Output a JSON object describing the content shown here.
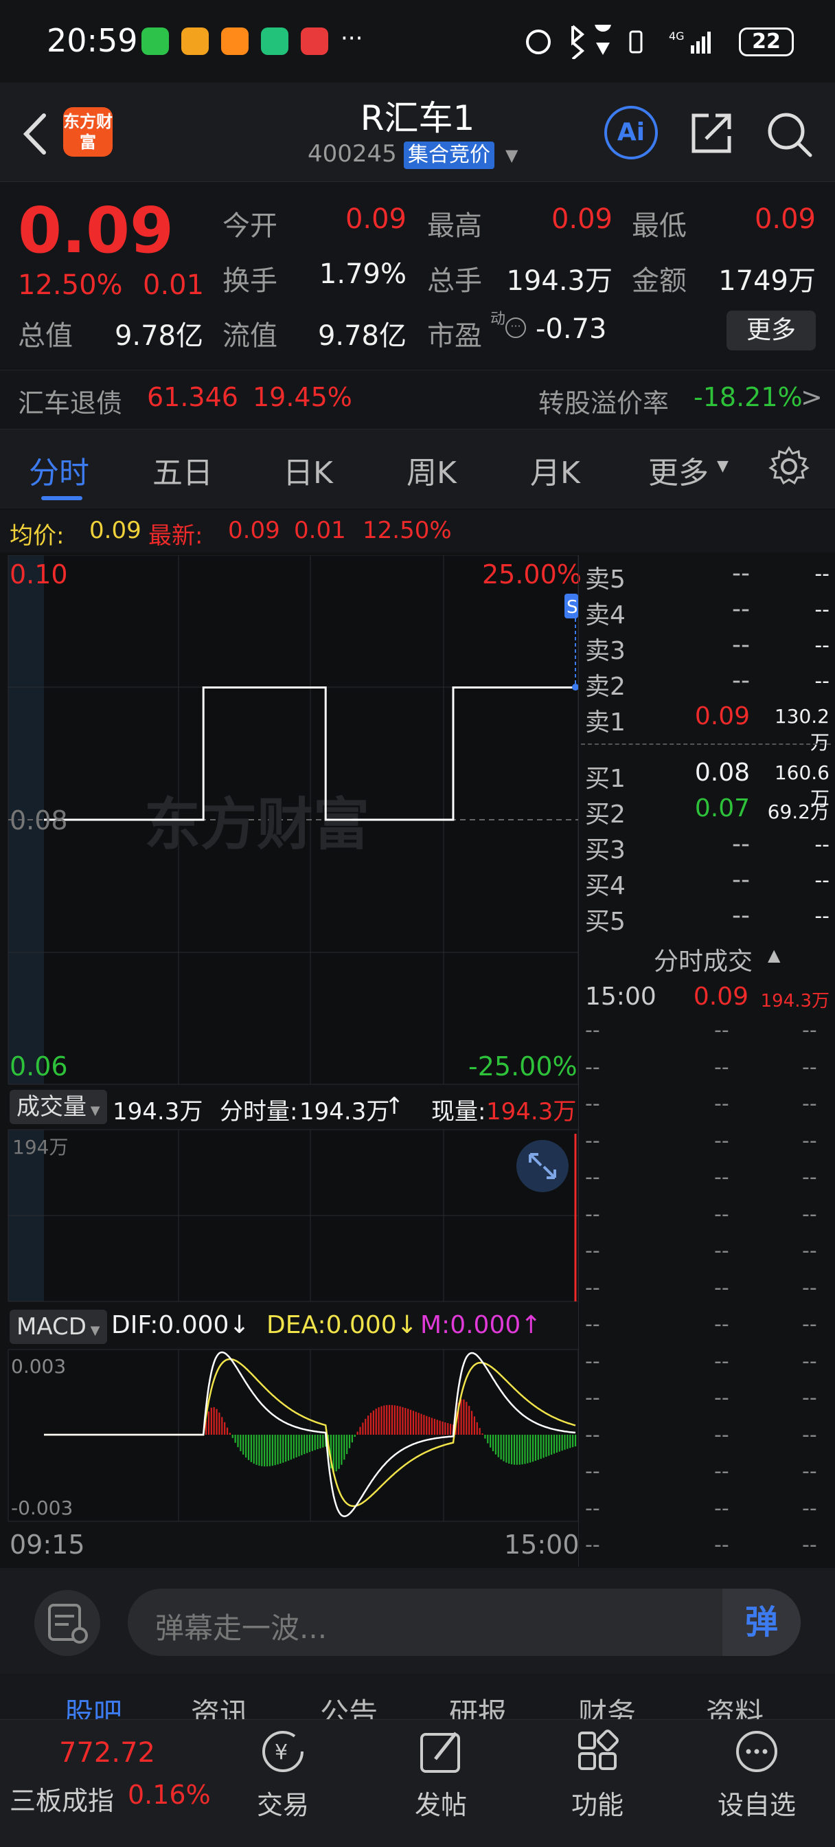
{
  "status_bar": {
    "time": "20:59",
    "network": "4G",
    "battery": "22"
  },
  "header": {
    "logo_text": "东方财富",
    "stock_name": "R汇车1",
    "stock_code": "400245",
    "auction_badge": "集合竞价"
  },
  "quote": {
    "price": "0.09",
    "change_pct": "12.50%",
    "change": "0.01",
    "open_label": "今开",
    "open": "0.09",
    "high_label": "最高",
    "high": "0.09",
    "low_label": "最低",
    "low": "0.09",
    "turnover_label": "换手",
    "turnover": "1.79%",
    "volume_label": "总手",
    "volume": "194.3万",
    "amount_label": "金额",
    "amount": "1749万",
    "mktcap_label": "总值",
    "mktcap": "9.78亿",
    "float_label": "流值",
    "float": "9.78亿",
    "pe_label": "市盈",
    "pe_sup": "动",
    "pe": "-0.73",
    "more_label": "更多"
  },
  "bond": {
    "name": "汇车退债",
    "price": "61.346",
    "pct": "19.45%",
    "premium_label": "转股溢价率",
    "premium": "-18.21%",
    "arrow": ">"
  },
  "tabs": [
    "分时",
    "五日",
    "日K",
    "周K",
    "月K",
    "更多"
  ],
  "info_row": {
    "avg_label": "均价:",
    "avg": "0.09",
    "latest_label": "最新:",
    "latest": "0.09",
    "chg": "0.01",
    "pct": "12.50%"
  },
  "price_chart": {
    "y_top": "0.10",
    "y_mid": "0.08",
    "y_bottom": "0.06",
    "pct_top": "25.00%",
    "pct_bottom": "-25.00%",
    "watermark": "东方财富",
    "marker": "S"
  },
  "volume": {
    "selector": "成交量",
    "total": "194.3万",
    "fenshi_label": "分时量:",
    "fenshi": "194.3万",
    "fenshi_arrow": "↑",
    "current_label": "现量:",
    "current": "194.3万",
    "axis_max": "194万"
  },
  "macd": {
    "selector": "MACD",
    "dif": "DIF:0.000↓",
    "dea": "DEA:0.000↓",
    "m": "M:0.000↑",
    "y_top": "0.003",
    "y_bottom": "-0.003",
    "time_start": "09:15",
    "time_end": "15:00"
  },
  "chart_data": {
    "type": "line",
    "title": "",
    "xlabel": "",
    "ylabel": "",
    "x_range": [
      "09:15",
      "15:00"
    ],
    "ylim": [
      0.06,
      0.1
    ],
    "series": [
      {
        "x": [
          0,
          0.3,
          0.3,
          0.53,
          0.53,
          0.77,
          0.77,
          1
        ],
        "values": [
          0.08,
          0.08,
          0.09,
          0.09,
          0.08,
          0.08,
          0.09,
          0.09
        ]
      }
    ],
    "grid": true
  },
  "orderbook": {
    "asks": [
      {
        "label": "卖5",
        "price": "--",
        "vol": "--"
      },
      {
        "label": "卖4",
        "price": "--",
        "vol": "--"
      },
      {
        "label": "卖3",
        "price": "--",
        "vol": "--"
      },
      {
        "label": "卖2",
        "price": "--",
        "vol": "--"
      },
      {
        "label": "卖1",
        "price": "0.09",
        "vol": "130.2万"
      }
    ],
    "bids": [
      {
        "label": "买1",
        "price": "0.08",
        "vol": "160.6万"
      },
      {
        "label": "买2",
        "price": "0.07",
        "vol": "69.2万"
      },
      {
        "label": "买3",
        "price": "--",
        "vol": "--"
      },
      {
        "label": "买4",
        "price": "--",
        "vol": "--"
      },
      {
        "label": "买5",
        "price": "--",
        "vol": "--"
      }
    ],
    "trades_title": "分时成交",
    "trade": {
      "time": "15:00",
      "price": "0.09",
      "vol": "194.3万"
    },
    "placeholder": "--"
  },
  "comment": {
    "placeholder": "弹幕走一波...",
    "danmu": "弹"
  },
  "sub_tabs": [
    "股吧",
    "资讯",
    "公告",
    "研报",
    "财务",
    "资料"
  ],
  "bottom_nav": {
    "index_value": "772.72",
    "index_name": "三板成指",
    "index_pct": "0.16%",
    "items": [
      "交易",
      "发帖",
      "功能",
      "设自选"
    ]
  }
}
